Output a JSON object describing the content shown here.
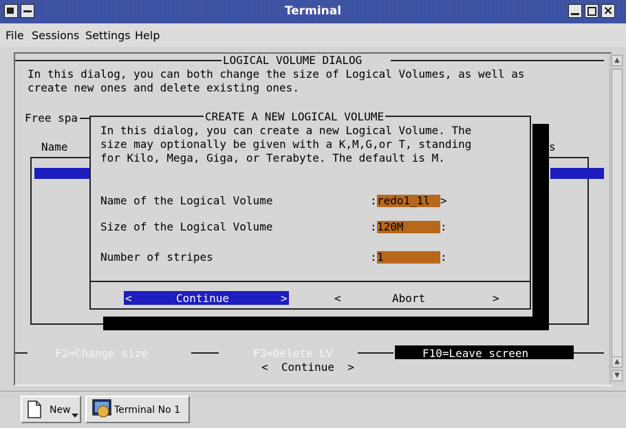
{
  "window": {
    "title": "Terminal"
  },
  "menu": {
    "items": [
      "File",
      "Sessions",
      "Settings",
      "Help"
    ]
  },
  "outer_dialog": {
    "title": "LOGICAL VOLUME DIALOG",
    "desc_line1": "In this dialog, you can both change the size of Logical Volumes, as well as",
    "desc_line2": "create new ones and delete existing ones.",
    "free_space_label": "Free spa",
    "name_column": "Name",
    "right_column_fragment": "s"
  },
  "create_dialog": {
    "title": "CREATE A NEW LOGICAL VOLUME",
    "desc_line1": "In this dialog, you can create a new Logical Volume. The",
    "desc_line2": "size may optionally be given with a K,M,G,or T, standing",
    "desc_line3": "for Kilo, Mega, Giga, or Terabyte. The default is M.",
    "fields": [
      {
        "label": "Name of the Logical Volume",
        "value": "redo1_1l",
        "end": ">"
      },
      {
        "label": "Size of the Logical Volume",
        "value": "120M",
        "end": ":"
      },
      {
        "label": "Number of stripes",
        "value": "1",
        "end": ":"
      }
    ],
    "field_prefix": ":",
    "continue_button": {
      "left": "<",
      "label": "Continue",
      "right": ">"
    },
    "abort_button": {
      "left": "<",
      "label": "Abort",
      "right": ">"
    }
  },
  "function_keys": {
    "f2": "F2=Change size",
    "f3": "F3=Delete LV",
    "f10": "F10=Leave screen",
    "continue": "<  Continue  >"
  },
  "taskbar": {
    "new_label": "New",
    "terminal_label": "Terminal No 1"
  },
  "colors": {
    "titlebar": "#3a4fa0",
    "selection_blue": "#1d1dc0",
    "field_orange": "#b8681a"
  }
}
